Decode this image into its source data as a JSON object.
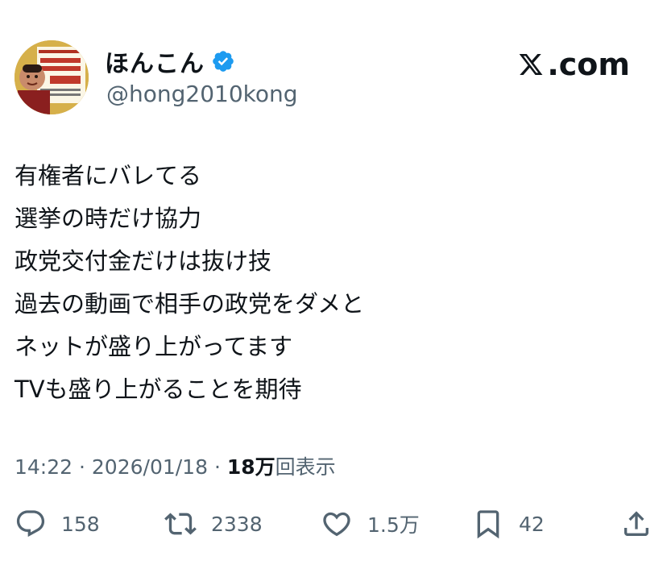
{
  "author": {
    "display_name": "ほんこん",
    "handle": "@hong2010kong",
    "verified": true,
    "verified_color": "#1d9bf0",
    "avatar_text": "ウイルスから国民を守るのも国防や"
  },
  "brand": {
    "label": ".com"
  },
  "tweet": {
    "lines": [
      "有権者にバレてる",
      "選挙の時だけ協力",
      "政党交付金だけは抜け技",
      "過去の動画で相手の政党をダメと",
      "ネットが盛り上がってます",
      "TVも盛り上がることを期待"
    ]
  },
  "meta": {
    "time": "14:22",
    "separator": "·",
    "date": "2026/01/18",
    "views_count": "18万",
    "views_label": "回表示"
  },
  "actions": {
    "reply": {
      "icon": "reply-icon",
      "count": "158"
    },
    "retweet": {
      "icon": "retweet-icon",
      "count": "2338"
    },
    "like": {
      "icon": "heart-icon",
      "count": "1.5万"
    },
    "bookmark": {
      "icon": "bookmark-icon",
      "count": "42"
    },
    "share": {
      "icon": "share-icon"
    }
  },
  "colors": {
    "text": "#0f1419",
    "secondary": "#536471"
  }
}
